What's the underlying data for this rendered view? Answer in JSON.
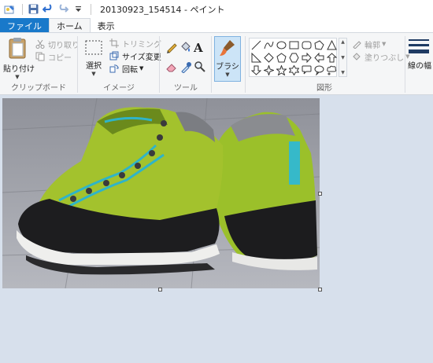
{
  "window": {
    "title": "20130923_154514 - ペイント"
  },
  "quick_access": {
    "icons": [
      "paint-app-icon",
      "save-icon",
      "undo-icon",
      "redo-icon",
      "customize-dropdown-icon"
    ]
  },
  "tabs": [
    {
      "label": "ファイル"
    },
    {
      "label": "ホーム"
    },
    {
      "label": "表示"
    }
  ],
  "ribbon": {
    "clipboard": {
      "paste_label": "貼り付け",
      "cut_label": "切り取り",
      "copy_label": "コピー",
      "group_label": "クリップボード"
    },
    "image": {
      "select_label": "選択",
      "crop_label": "トリミング",
      "resize_label": "サイズ変更",
      "rotate_label": "回転",
      "group_label": "イメージ"
    },
    "tools": {
      "group_label": "ツール",
      "text_tool_glyph": "A"
    },
    "brush": {
      "label": "ブラシ"
    },
    "shapes": {
      "outline_label": "輪郭",
      "fill_label": "塗りつぶし",
      "group_label": "図形"
    },
    "line_width": {
      "label": "線の幅"
    }
  },
  "colors": {
    "accent": "#1979ca",
    "workspace": "#d7e0ec",
    "ribbon": "#f5f6f7"
  }
}
